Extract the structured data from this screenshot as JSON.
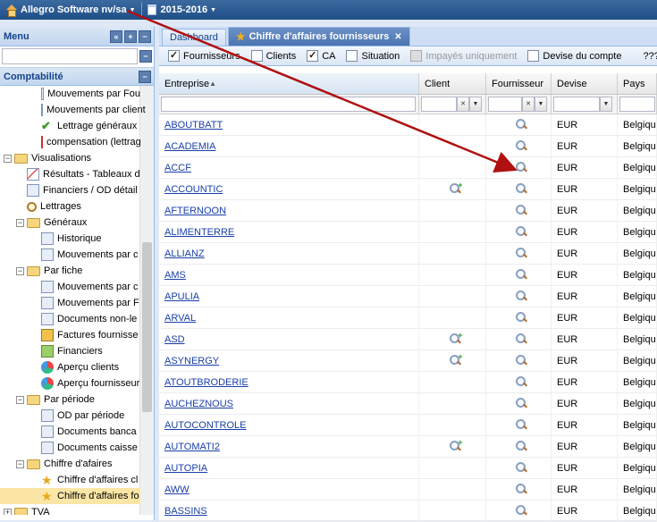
{
  "topbar": {
    "company": "Allegro Software nv/sa",
    "year": "2015-2016"
  },
  "menu": {
    "title": "Menu",
    "search_value": ""
  },
  "section": {
    "title": "Comptabilité"
  },
  "tree": [
    {
      "label": "Mouvements par Fou",
      "level": 2,
      "icon": "doc"
    },
    {
      "label": "Mouvements par client",
      "level": 2,
      "icon": "doc"
    },
    {
      "label": "Lettrage généraux",
      "level": 2,
      "icon": "chk"
    },
    {
      "label": "compensation (lettrag",
      "level": 2,
      "icon": "red"
    },
    {
      "label": "Visualisations",
      "level": 0,
      "icon": "folder",
      "toggle": "−"
    },
    {
      "label": "Résultats - Tableaux d",
      "level": 1,
      "icon": "graph"
    },
    {
      "label": "Financiers / OD détail",
      "level": 1,
      "icon": "doc"
    },
    {
      "label": "Lettrages",
      "level": 1,
      "icon": "lens"
    },
    {
      "label": "Généraux",
      "level": 1,
      "icon": "folder",
      "toggle": "−"
    },
    {
      "label": "Historique",
      "level": 2,
      "icon": "doc"
    },
    {
      "label": "Mouvements par c",
      "level": 2,
      "icon": "doc"
    },
    {
      "label": "Par fiche",
      "level": 1,
      "icon": "folder",
      "toggle": "−"
    },
    {
      "label": "Mouvements par c",
      "level": 2,
      "icon": "doc"
    },
    {
      "label": "Mouvements par F",
      "level": 2,
      "icon": "doc"
    },
    {
      "label": "Documents non-le",
      "level": 2,
      "icon": "doc"
    },
    {
      "label": "Factures fournisse",
      "level": 2,
      "icon": "invoice"
    },
    {
      "label": "Financiers",
      "level": 2,
      "icon": "money"
    },
    {
      "label": "Aperçu clients",
      "level": 2,
      "icon": "pie"
    },
    {
      "label": "Aperçu fournisseur",
      "level": 2,
      "icon": "pie"
    },
    {
      "label": "Par période",
      "level": 1,
      "icon": "folder",
      "toggle": "−"
    },
    {
      "label": "OD par période",
      "level": 2,
      "icon": "doc"
    },
    {
      "label": "Documents banca",
      "level": 2,
      "icon": "doc"
    },
    {
      "label": "Documents caisse",
      "level": 2,
      "icon": "doc"
    },
    {
      "label": "Chiffre d'afaires",
      "level": 1,
      "icon": "folder",
      "toggle": "−"
    },
    {
      "label": "Chiffre d'affaires cl",
      "level": 2,
      "icon": "star"
    },
    {
      "label": "Chiffre d'affaires fo",
      "level": 2,
      "icon": "star",
      "selected": true
    },
    {
      "label": "TVA",
      "level": 0,
      "icon": "folder",
      "toggle": "+"
    }
  ],
  "tabs": [
    {
      "label": "Dashboard",
      "active": false
    },
    {
      "label": "Chiffre d'affaires fournisseurs",
      "active": true
    }
  ],
  "filters": [
    {
      "label": "Fournisseurs",
      "checked": true,
      "disabled": false
    },
    {
      "label": "Clients",
      "checked": false,
      "disabled": false
    },
    {
      "label": "CA",
      "checked": true,
      "disabled": false
    },
    {
      "label": "Situation",
      "checked": false,
      "disabled": false
    },
    {
      "label": "Impayés uniquement",
      "checked": false,
      "disabled": true
    },
    {
      "label": "Devise du compte",
      "checked": false,
      "disabled": false
    }
  ],
  "filters_extra": "???Re",
  "columns": [
    "Entreprise",
    "Client",
    "Fournisseur",
    "Devise",
    "Pays"
  ],
  "rows": [
    {
      "name": "ABOUTBATT",
      "client": false,
      "devise": "EUR",
      "pays": "Belgique"
    },
    {
      "name": "ACADEMIA",
      "client": false,
      "devise": "EUR",
      "pays": "Belgique"
    },
    {
      "name": "ACCF",
      "client": false,
      "devise": "EUR",
      "pays": "Belgique"
    },
    {
      "name": "ACCOUNTIC",
      "client": true,
      "devise": "EUR",
      "pays": "Belgique"
    },
    {
      "name": "AFTERNOON",
      "client": false,
      "devise": "EUR",
      "pays": "Belgique"
    },
    {
      "name": "ALIMENTERRE",
      "client": false,
      "devise": "EUR",
      "pays": "Belgique"
    },
    {
      "name": "ALLIANZ",
      "client": false,
      "devise": "EUR",
      "pays": "Belgique"
    },
    {
      "name": "AMS",
      "client": false,
      "devise": "EUR",
      "pays": "Belgique"
    },
    {
      "name": "APULIA",
      "client": false,
      "devise": "EUR",
      "pays": "Belgique"
    },
    {
      "name": "ARVAL",
      "client": false,
      "devise": "EUR",
      "pays": "Belgique"
    },
    {
      "name": "ASD",
      "client": true,
      "devise": "EUR",
      "pays": "Belgique"
    },
    {
      "name": "ASYNERGY",
      "client": true,
      "devise": "EUR",
      "pays": "Belgique"
    },
    {
      "name": "ATOUTBRODERIE",
      "client": false,
      "devise": "EUR",
      "pays": "Belgique"
    },
    {
      "name": "AUCHEZNOUS",
      "client": false,
      "devise": "EUR",
      "pays": "Belgique"
    },
    {
      "name": "AUTOCONTROLE",
      "client": false,
      "devise": "EUR",
      "pays": "Belgique"
    },
    {
      "name": "AUTOMATI2",
      "client": true,
      "devise": "EUR",
      "pays": "Belgique"
    },
    {
      "name": "AUTOPIA",
      "client": false,
      "devise": "EUR",
      "pays": "Belgique"
    },
    {
      "name": "AWW",
      "client": false,
      "devise": "EUR",
      "pays": "Belgique"
    },
    {
      "name": "BASSINS",
      "client": false,
      "devise": "EUR",
      "pays": "Belgique"
    }
  ],
  "colors": {
    "header_blue": "#1f4f87",
    "link": "#1a3fa8",
    "arrow": "#b01010",
    "selection": "#fbe6a6"
  }
}
